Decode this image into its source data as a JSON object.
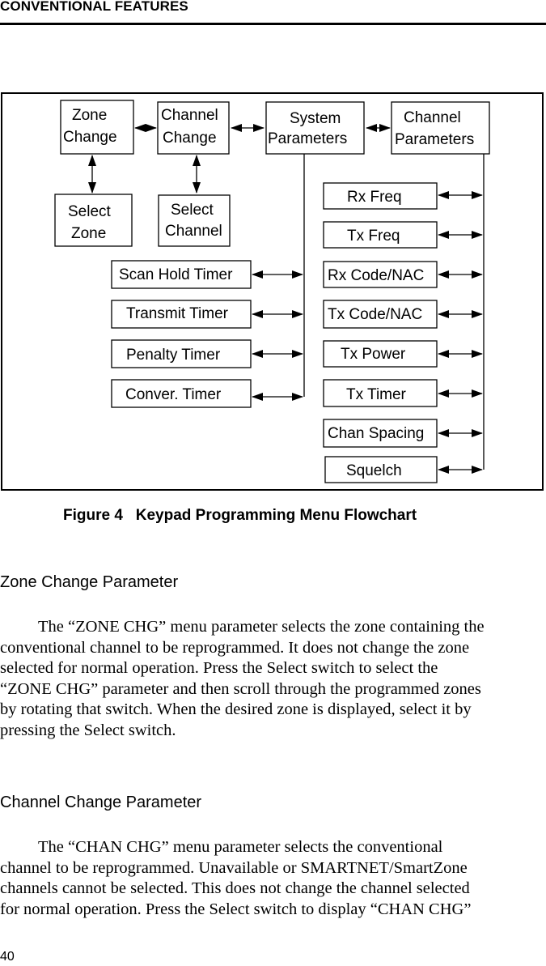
{
  "header": {
    "title": "CONVENTIONAL FEATURES"
  },
  "figure": {
    "caption": "Figure 4   Keypad Programming Menu Flowchart",
    "boxes": {
      "zone_change": [
        "Zone",
        "Change"
      ],
      "channel_change": [
        "Channel",
        "Change"
      ],
      "system_parameters": [
        "System",
        "Parameters"
      ],
      "channel_parameters": [
        "Channel",
        "Parameters"
      ],
      "select_zone": [
        "Select",
        "Zone"
      ],
      "select_channel": [
        "Select",
        "Channel"
      ],
      "scan_hold_timer": "Scan Hold Timer",
      "transmit_timer": "Transmit Timer",
      "penalty_timer": "Penalty Timer",
      "conver_timer": "Conver. Timer",
      "rx_freq": "Rx Freq",
      "tx_freq": "Tx Freq",
      "rx_code_nac": "Rx Code/NAC",
      "tx_code_nac": "Tx Code/NAC",
      "tx_power": "Tx Power",
      "tx_timer": "Tx Timer",
      "chan_spacing": "Chan Spacing",
      "squelch": "Squelch"
    }
  },
  "sections": [
    {
      "heading": "Zone Change Parameter",
      "lines": [
        "The “ZONE CHG” menu parameter selects the zone containing the",
        "conventional channel to be reprogrammed. It does not change the zone",
        "selected for normal operation. Press the Select switch to select the",
        "“ZONE CHG” parameter and then scroll through the programmed zones",
        "by rotating that switch. When the desired zone is displayed, select it by",
        "pressing the Select switch."
      ]
    },
    {
      "heading": "Channel Change Parameter",
      "lines": [
        "The “CHAN CHG” menu parameter selects the conventional",
        "channel to be reprogrammed. Unavailable or SMARTNET/SmartZone",
        "channels cannot be selected. This does not change the channel selected",
        "for normal operation. Press the Select switch to display “CHAN CHG”"
      ]
    }
  ],
  "footer": {
    "page_number": "40"
  }
}
